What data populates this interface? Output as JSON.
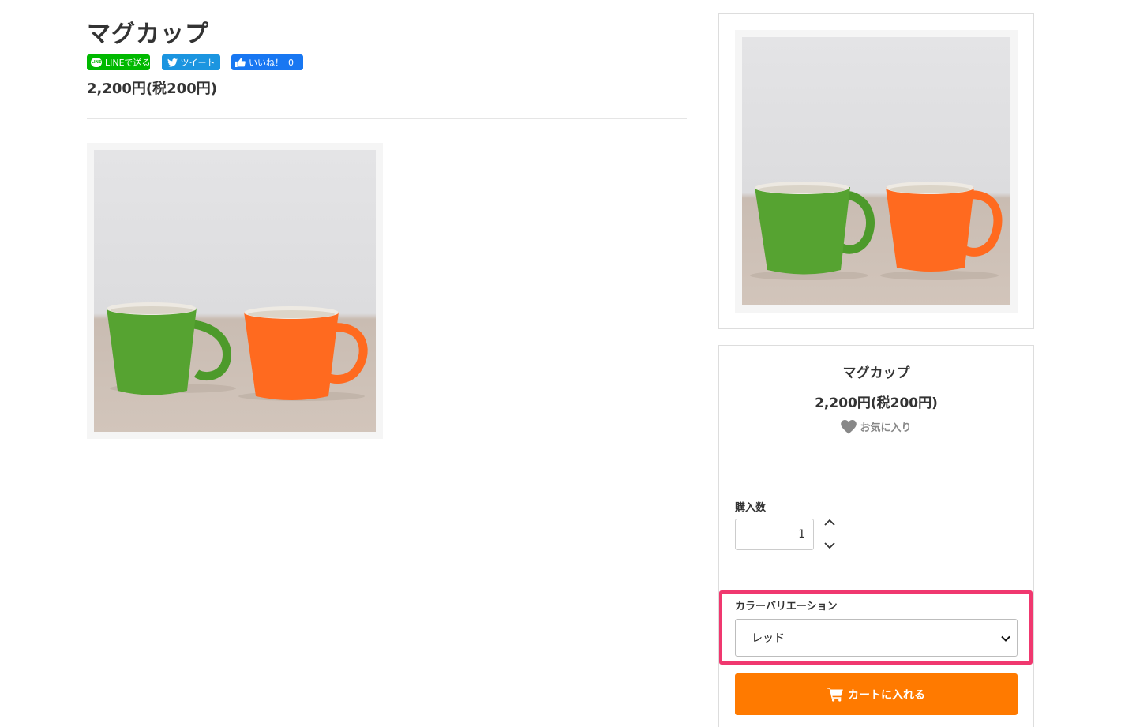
{
  "product": {
    "title": "マグカップ",
    "price": "2,200円(税200円)"
  },
  "social": {
    "line_logo": "LINE",
    "line_label": "LINEで送る",
    "tweet_label": "ツイート",
    "like_label": "いいね！",
    "like_count": "0",
    "colors": {
      "line": "#00b900",
      "twitter": "#1b95e0",
      "facebook": "#1877f2"
    }
  },
  "sidebar": {
    "title": "マグカップ",
    "price": "2,200円(税200円)",
    "favorite_label": "お気に入り",
    "quantity_label": "購入数",
    "quantity_value": "1",
    "variation_label": "カラーバリエーション",
    "variation_selected": "レッド",
    "cart_label": "カートに入れる"
  },
  "icons": [
    "line-icon",
    "twitter-bird-icon",
    "thumbs-up-icon",
    "heart-icon",
    "chevron-up-icon",
    "chevron-down-icon",
    "cart-icon"
  ],
  "theme": {
    "accent": "#ff7a00",
    "highlight": "#f0386f",
    "border": "#dddddd"
  }
}
